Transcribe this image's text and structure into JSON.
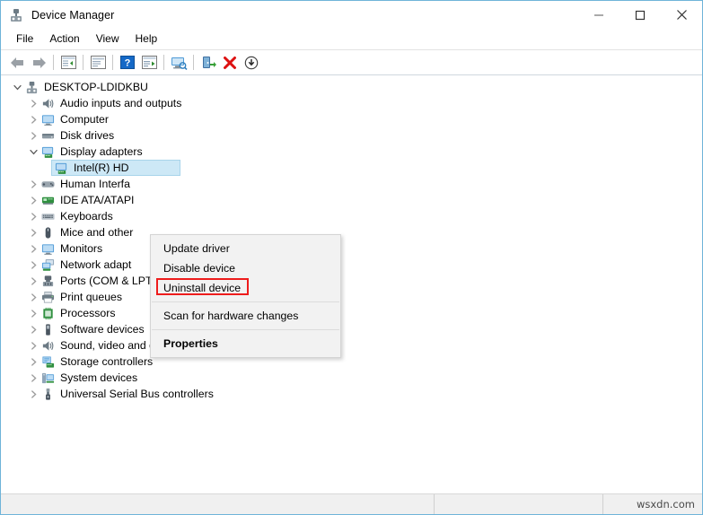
{
  "window": {
    "title": "Device Manager",
    "title_icon": "device-manager-icon",
    "controls": [
      {
        "name": "minimize",
        "glyph": "minimize-icon"
      },
      {
        "name": "maximize",
        "glyph": "maximize-icon"
      },
      {
        "name": "close",
        "glyph": "close-icon"
      }
    ],
    "border_color": "#6fb4d9"
  },
  "menubar": {
    "items": [
      {
        "label": "File",
        "name": "menu-file"
      },
      {
        "label": "Action",
        "name": "menu-action"
      },
      {
        "label": "View",
        "name": "menu-view"
      },
      {
        "label": "Help",
        "name": "menu-help"
      }
    ]
  },
  "toolbar": {
    "buttons": [
      {
        "name": "back-icon",
        "title": "Back"
      },
      {
        "name": "forward-icon",
        "title": "Forward"
      },
      {
        "name": "separator-1",
        "title": ""
      },
      {
        "name": "show-hide-console-tree-icon",
        "title": "Show/Hide Console Tree"
      },
      {
        "name": "separator-2",
        "title": ""
      },
      {
        "name": "properties-icon",
        "title": "Properties"
      },
      {
        "name": "separator-3",
        "title": ""
      },
      {
        "name": "help-icon",
        "title": "Help"
      },
      {
        "name": "update-driver-icon",
        "title": "Update driver"
      },
      {
        "name": "separator-4",
        "title": ""
      },
      {
        "name": "scan-for-hardware-changes-icon",
        "title": "Scan for hardware changes"
      },
      {
        "name": "separator-5",
        "title": ""
      },
      {
        "name": "enable-device-icon",
        "title": "Enable device"
      },
      {
        "name": "uninstall-device-icon",
        "title": "Uninstall device"
      },
      {
        "name": "disable-device-icon",
        "title": "Disable device"
      }
    ]
  },
  "tree": {
    "root": {
      "label": "DESKTOP-LDIDKBU",
      "icon": "computer-root-icon",
      "expanded": true,
      "depth": 0
    },
    "items": [
      {
        "label": "Audio inputs and outputs",
        "icon": "speaker-icon",
        "expanded": false,
        "depth": 1,
        "selected": false
      },
      {
        "label": "Computer",
        "icon": "monitor-icon",
        "expanded": false,
        "depth": 1,
        "selected": false
      },
      {
        "label": "Disk drives",
        "icon": "disk-drive-icon",
        "expanded": false,
        "depth": 1,
        "selected": false
      },
      {
        "label": "Display adapters",
        "icon": "display-adapter-icon",
        "expanded": true,
        "depth": 1,
        "selected": false
      },
      {
        "label": "Intel(R) HD",
        "icon": "display-adapter-icon",
        "expanded": null,
        "depth": 2,
        "selected": true
      },
      {
        "label": "Human Interfa",
        "icon": "hid-icon",
        "expanded": false,
        "depth": 1,
        "selected": false
      },
      {
        "label": "IDE ATA/ATAPI",
        "icon": "ide-controller-icon",
        "expanded": false,
        "depth": 1,
        "selected": false
      },
      {
        "label": "Keyboards",
        "icon": "keyboard-icon",
        "expanded": false,
        "depth": 1,
        "selected": false
      },
      {
        "label": "Mice and other",
        "icon": "mouse-icon",
        "expanded": false,
        "depth": 1,
        "selected": false
      },
      {
        "label": "Monitors",
        "icon": "monitor-icon",
        "expanded": false,
        "depth": 1,
        "selected": false
      },
      {
        "label": "Network adapt",
        "icon": "network-adapter-icon",
        "expanded": false,
        "depth": 1,
        "selected": false
      },
      {
        "label": "Ports (COM & LPT)",
        "icon": "port-icon",
        "expanded": false,
        "depth": 1,
        "selected": false
      },
      {
        "label": "Print queues",
        "icon": "printer-icon",
        "expanded": false,
        "depth": 1,
        "selected": false
      },
      {
        "label": "Processors",
        "icon": "processor-icon",
        "expanded": false,
        "depth": 1,
        "selected": false
      },
      {
        "label": "Software devices",
        "icon": "software-device-icon",
        "expanded": false,
        "depth": 1,
        "selected": false
      },
      {
        "label": "Sound, video and game controllers",
        "icon": "speaker-icon",
        "expanded": false,
        "depth": 1,
        "selected": false
      },
      {
        "label": "Storage controllers",
        "icon": "storage-controller-icon",
        "expanded": false,
        "depth": 1,
        "selected": false
      },
      {
        "label": "System devices",
        "icon": "system-device-icon",
        "expanded": false,
        "depth": 1,
        "selected": false
      },
      {
        "label": "Universal Serial Bus controllers",
        "icon": "usb-icon",
        "expanded": false,
        "depth": 1,
        "selected": false
      }
    ]
  },
  "context_menu": {
    "items": [
      {
        "label": "Update driver",
        "name": "ctx-update-driver",
        "bold": false,
        "type": "item"
      },
      {
        "label": "Disable device",
        "name": "ctx-disable-device",
        "bold": false,
        "type": "item"
      },
      {
        "label": "Uninstall device",
        "name": "ctx-uninstall-device",
        "bold": false,
        "type": "item",
        "highlighted": true
      },
      {
        "type": "separator"
      },
      {
        "label": "Scan for hardware changes",
        "name": "ctx-scan-for-hardware-changes",
        "bold": false,
        "type": "item"
      },
      {
        "type": "separator"
      },
      {
        "label": "Properties",
        "name": "ctx-properties",
        "bold": true,
        "type": "item"
      }
    ],
    "highlight_color": "#ee1c1c"
  },
  "statusbar": {
    "main": "",
    "middle": "",
    "watermark": "wsxdn.com"
  }
}
